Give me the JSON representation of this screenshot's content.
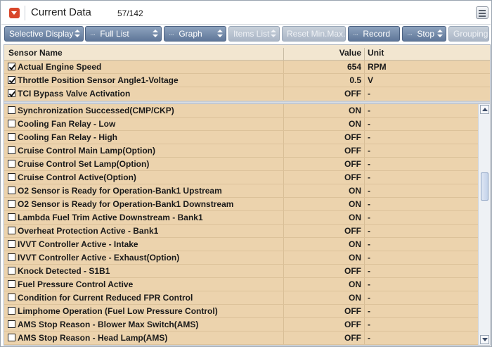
{
  "title": {
    "label": "Current Data",
    "count": "57/142"
  },
  "toolbar": {
    "buttons": [
      {
        "label": "Selective Display",
        "dots": false,
        "disabled": false
      },
      {
        "label": "Full List",
        "dots": true,
        "disabled": false
      },
      {
        "label": "Graph",
        "dots": true,
        "disabled": false
      },
      {
        "label": "Items List",
        "dots": false,
        "disabled": true
      },
      {
        "label": "Reset Min.Max.",
        "dots": false,
        "disabled": true
      },
      {
        "label": "Record",
        "dots": true,
        "disabled": false
      },
      {
        "label": "Stop",
        "dots": true,
        "disabled": false
      },
      {
        "label": "Grouping",
        "dots": false,
        "disabled": true
      }
    ]
  },
  "table": {
    "headers": {
      "name": "Sensor Name",
      "value": "Value",
      "unit": "Unit"
    },
    "pinned_rows": [
      {
        "name": "Actual Engine Speed",
        "value": "654",
        "unit": "RPM",
        "checked": true
      },
      {
        "name": "Throttle Position Sensor Angle1-Voltage",
        "value": "0.5",
        "unit": "V",
        "checked": true
      },
      {
        "name": "TCI Bypass Valve Activation",
        "value": "OFF",
        "unit": "-",
        "checked": true
      }
    ],
    "rows": [
      {
        "name": "Synchronization Successed(CMP/CKP)",
        "value": "ON",
        "unit": "-",
        "checked": false
      },
      {
        "name": "Cooling Fan Relay - Low",
        "value": "ON",
        "unit": "-",
        "checked": false
      },
      {
        "name": "Cooling Fan Relay - High",
        "value": "OFF",
        "unit": "-",
        "checked": false
      },
      {
        "name": "Cruise Control Main Lamp(Option)",
        "value": "OFF",
        "unit": "-",
        "checked": false
      },
      {
        "name": "Cruise Control Set Lamp(Option)",
        "value": "OFF",
        "unit": "-",
        "checked": false
      },
      {
        "name": "Cruise Control Active(Option)",
        "value": "OFF",
        "unit": "-",
        "checked": false
      },
      {
        "name": "O2 Sensor is Ready for Operation-Bank1 Upstream",
        "value": "ON",
        "unit": "-",
        "checked": false
      },
      {
        "name": "O2 Sensor is Ready for Operation-Bank1 Downstream",
        "value": "ON",
        "unit": "-",
        "checked": false
      },
      {
        "name": "Lambda Fuel Trim Active Downstream - Bank1",
        "value": "ON",
        "unit": "-",
        "checked": false
      },
      {
        "name": "Overheat Protection Active - Bank1",
        "value": "OFF",
        "unit": "-",
        "checked": false
      },
      {
        "name": "IVVT Controller Active - Intake",
        "value": "ON",
        "unit": "-",
        "checked": false
      },
      {
        "name": "IVVT Controller Active - Exhaust(Option)",
        "value": "ON",
        "unit": "-",
        "checked": false
      },
      {
        "name": "Knock Detected - S1B1",
        "value": "OFF",
        "unit": "-",
        "checked": false
      },
      {
        "name": "Fuel Pressure Control Active",
        "value": "ON",
        "unit": "-",
        "checked": false
      },
      {
        "name": "Condition for Current Reduced FPR Control",
        "value": "ON",
        "unit": "-",
        "checked": false
      },
      {
        "name": "Limphome Operation (Fuel Low Pressure Control)",
        "value": "OFF",
        "unit": "-",
        "checked": false
      },
      {
        "name": "AMS Stop Reason - Blower Max Switch(AMS)",
        "value": "OFF",
        "unit": "-",
        "checked": false
      },
      {
        "name": "AMS Stop Reason - Head Lamp(AMS)",
        "value": "OFF",
        "unit": "-",
        "checked": false
      }
    ]
  },
  "colors": {
    "row_bg": "#ecd3ad",
    "header_bg": "#f2e6d0",
    "button_bg": "#6f86a8",
    "title_icon": "#d9462a"
  }
}
